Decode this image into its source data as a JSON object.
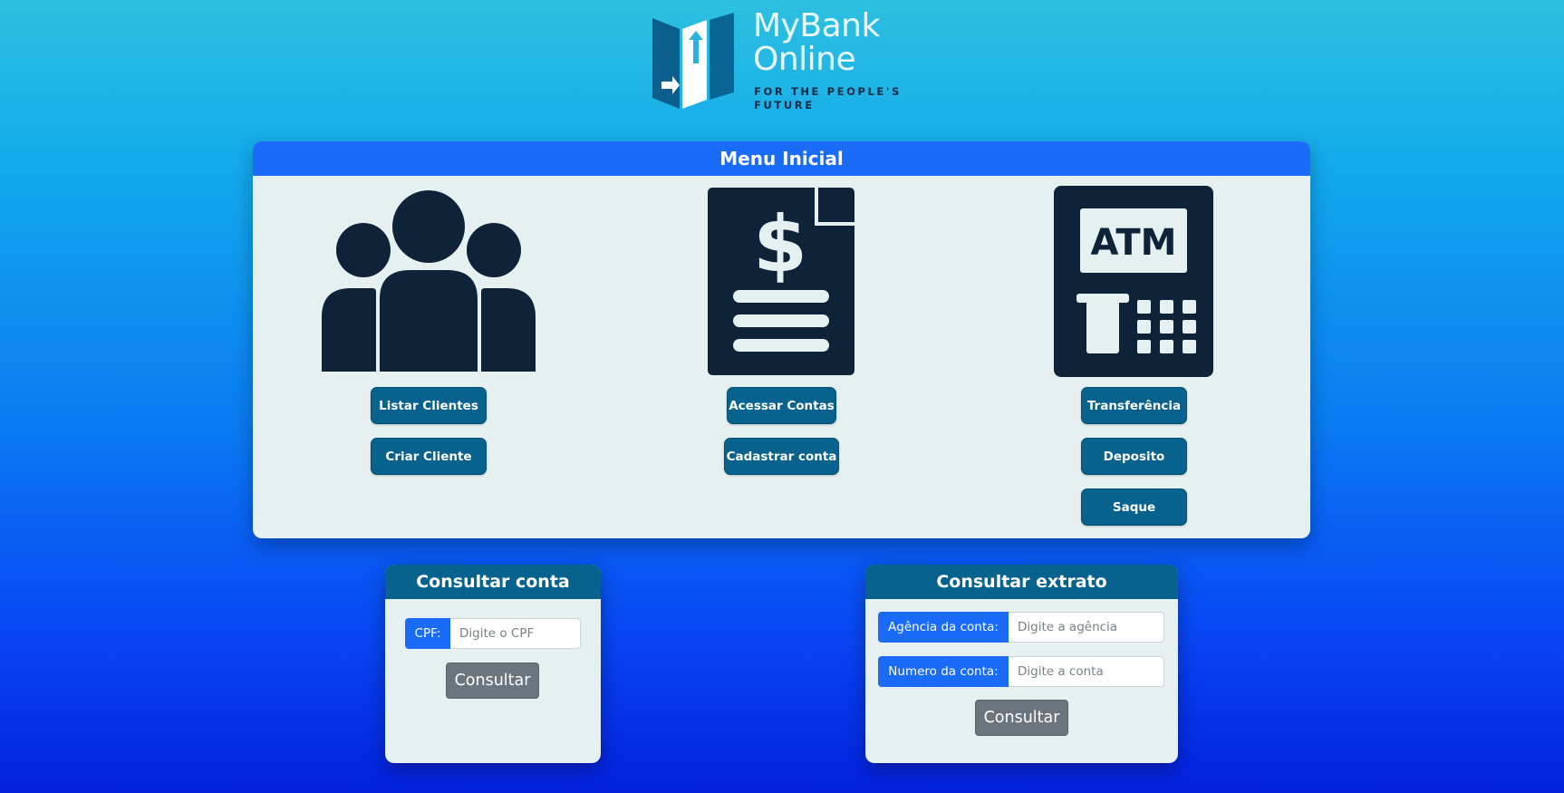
{
  "logo": {
    "name_line1": "MyBank",
    "name_line2": "Online",
    "tagline_line1": "FOR THE PEOPLE'S",
    "tagline_line2": "FUTURE"
  },
  "menu": {
    "title": "Menu Inicial",
    "clients": {
      "icon": "users-group-icon",
      "buttons": [
        "Listar Clientes",
        "Criar Cliente"
      ]
    },
    "accounts": {
      "icon": "dollar-document-icon",
      "buttons": [
        "Acessar Contas",
        "Cadastrar conta"
      ]
    },
    "atm": {
      "icon": "atm-icon",
      "icon_text": "ATM",
      "buttons": [
        "Transferência",
        "Deposito",
        "Saque"
      ]
    }
  },
  "consultar_conta": {
    "title": "Consultar conta",
    "cpf_label": "CPF:",
    "cpf_placeholder": "Digite o CPF",
    "button": "Consultar"
  },
  "consultar_extrato": {
    "title": "Consultar extrato",
    "agencia_label": "Agência da conta:",
    "agencia_placeholder": "Digite a agência",
    "conta_label": "Numero da conta:",
    "conta_placeholder": "Digite a conta",
    "button": "Consultar"
  },
  "colors": {
    "header_blue": "#1a6cf8",
    "button_teal": "#08628e",
    "card_bg": "#e6f0f1",
    "icon_navy": "#0f2338",
    "consultar_gray": "#6a757d"
  }
}
